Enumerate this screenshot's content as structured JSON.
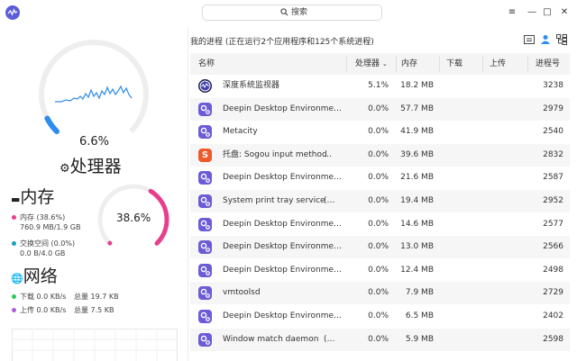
{
  "search": {
    "placeholder": "搜索"
  },
  "window_controls": [
    "≡",
    "—",
    "□",
    "✕"
  ],
  "cpu": {
    "percent_text": "6.6%",
    "title": "处理器",
    "value": 0.066
  },
  "memory": {
    "title": "内存",
    "mem_label": "内存 (38.6%)",
    "mem_detail": "760.9 MB/1.9 GB",
    "swap_label": "交换空间 (0.0%)",
    "swap_detail": "0.0 B/4.0 GB",
    "percent_text": "38.6%",
    "value": 0.386
  },
  "network": {
    "title": "网络",
    "download_label": "下载 0.0 KB/s",
    "download_total": "总量 19.7 KB",
    "upload_label": "上传 0.0 KB/s",
    "upload_total": "总量 7.5 KB"
  },
  "summary": "我的进程 (正在运行2个应用程序和125个系统进程)",
  "columns": {
    "name": "名称",
    "cpu": "处理器",
    "mem": "内存",
    "down": "下载",
    "up": "上传",
    "pid": "进程号"
  },
  "processes": [
    {
      "name": "深度系统监视器",
      "cpu": "5.1%",
      "mem": "18.2 MB",
      "pid": "3238",
      "icon": "deepin-monitor-icon"
    },
    {
      "name": "Deepin Desktop Environme…",
      "cpu": "0.0%",
      "mem": "57.7 MB",
      "pid": "2979",
      "icon": "process-gear-icon"
    },
    {
      "name": "Metacity",
      "cpu": "0.0%",
      "mem": "41.9 MB",
      "pid": "2540",
      "icon": "process-gear-icon"
    },
    {
      "name": "托盘: Sogou input method",
      "cpu": "0.0%",
      "mem": "39.6 MB",
      "pid": "2832",
      "icon": "sogou-icon",
      "extra": "…"
    },
    {
      "name": "Deepin Desktop Environme…",
      "cpu": "0.0%",
      "mem": "21.6 MB",
      "pid": "2587",
      "icon": "process-gear-icon"
    },
    {
      "name": "System print tray service",
      "cpu": "0.0%",
      "mem": "19.4 MB",
      "pid": "2952",
      "icon": "process-gear-icon",
      "extra": "(…"
    },
    {
      "name": "Deepin Desktop Environme…",
      "cpu": "0.0%",
      "mem": "14.6 MB",
      "pid": "2577",
      "icon": "process-gear-icon"
    },
    {
      "name": "Deepin Desktop Environme…",
      "cpu": "0.0%",
      "mem": "13.0 MB",
      "pid": "2566",
      "icon": "process-gear-icon"
    },
    {
      "name": "Deepin Desktop Environme…",
      "cpu": "0.0%",
      "mem": "12.4 MB",
      "pid": "2498",
      "icon": "process-gear-icon"
    },
    {
      "name": "vmtoolsd",
      "cpu": "0.0%",
      "mem": "7.9 MB",
      "pid": "2729",
      "icon": "process-gear-icon"
    },
    {
      "name": "Deepin Desktop Environme…",
      "cpu": "0.0%",
      "mem": "6.5 MB",
      "pid": "2402",
      "icon": "process-gear-icon"
    },
    {
      "name": "Window match daemon",
      "cpu": "0.0%",
      "mem": "5.9 MB",
      "pid": "2598",
      "icon": "process-gear-icon",
      "extra": "(…"
    }
  ],
  "colors": {
    "accent": "#2d8cf0",
    "memory": "#e83e8c",
    "swap": "#13a2b8",
    "download": "#34c759",
    "upload": "#b35ad6",
    "icon_purple": "#6b5bd6",
    "sogou": "#f0592a"
  }
}
